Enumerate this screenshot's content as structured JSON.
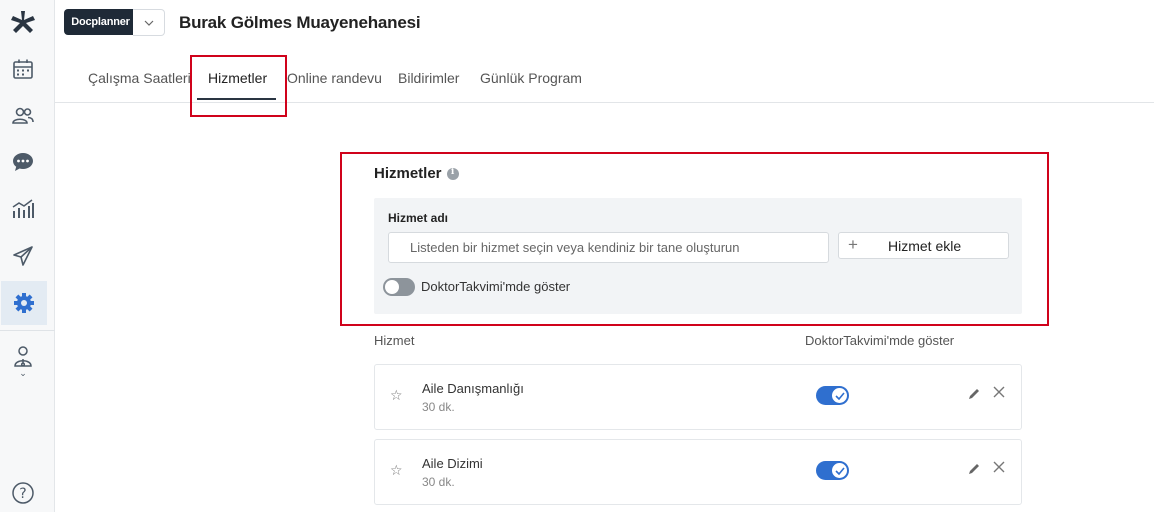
{
  "header": {
    "brand": "Docplanner",
    "title": "Burak Gölmes Muayenehanesi"
  },
  "tabs": [
    {
      "label": "Çalışma Saatleri"
    },
    {
      "label": "Hizmetler"
    },
    {
      "label": "Online randevu"
    },
    {
      "label": "Bildirimler"
    },
    {
      "label": "Günlük Program"
    }
  ],
  "sidebar": {
    "items": [
      {
        "icon": "logo-icon"
      },
      {
        "icon": "calendar-icon"
      },
      {
        "icon": "patients-icon"
      },
      {
        "icon": "messages-icon"
      },
      {
        "icon": "stats-icon"
      },
      {
        "icon": "send-icon"
      },
      {
        "icon": "settings-icon",
        "active": true
      },
      {
        "icon": "doctor-profile-icon"
      },
      {
        "icon": "help-icon"
      }
    ]
  },
  "services": {
    "title": "Hizmetler",
    "field_label": "Hizmet adı",
    "input_placeholder": "Listeden bir hizmet seçin veya kendiniz bir tane oluşturun",
    "add_button": "Hizmet ekle",
    "toggle_label": "DoktorTakvimi'mde göster"
  },
  "list": {
    "col_service": "Hizmet",
    "col_show": "DoktorTakvimi'mde göster",
    "rows": [
      {
        "name": "Aile Danışmanlığı",
        "duration": "30 dk.",
        "shown": true
      },
      {
        "name": "Aile Dizimi",
        "duration": "30 dk.",
        "shown": true
      }
    ]
  },
  "colors": {
    "accent": "#2f6fcf",
    "highlight": "#d0021b",
    "brand_bg": "#1f2a37"
  }
}
